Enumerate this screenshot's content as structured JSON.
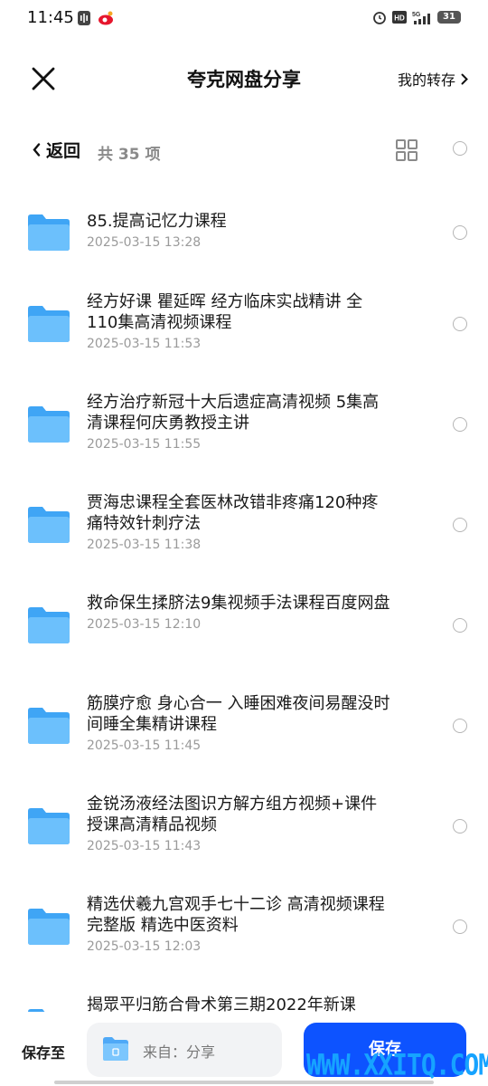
{
  "status_bar": {
    "time": "11:45",
    "network": "5G",
    "battery": "31"
  },
  "header": {
    "title": "夸克网盘分享",
    "my_transfer": "我的转存"
  },
  "subbar": {
    "back_label": "返回",
    "count": "共 35 项"
  },
  "files": [
    {
      "name": "85.提高记忆力课程",
      "date": "2025-03-15 13:28"
    },
    {
      "name": "经方好课 瞿延晖 经方临床实战精讲 全110集高清视频课程",
      "date": "2025-03-15 11:53"
    },
    {
      "name": "经方治疗新冠十大后遗症高清视频 5集高清课程何庆勇教授主讲",
      "date": "2025-03-15 11:55"
    },
    {
      "name": "贾海忠课程全套医林改错非疼痛120种疼痛特效针刺疗法",
      "date": "2025-03-15 11:38"
    },
    {
      "name": "救命保生揉脐法9集视频手法课程百度网盘",
      "date": "2025-03-15 12:10"
    },
    {
      "name": "筋膜疗愈 身心合一  入睡困难夜间易醒没时间睡全集精讲课程",
      "date": "2025-03-15 11:45"
    },
    {
      "name": "金锐汤液经法图识方解方组方视频+课件授课高清精品视频",
      "date": "2025-03-15 11:43"
    },
    {
      "name": "精选伏羲九宫观手七十二诊 高清视频课程完整版 精选中医资料",
      "date": "2025-03-15 12:03"
    },
    {
      "name": "揭眾平归筋合骨术第三期2022年新课",
      "date": ""
    }
  ],
  "bottom": {
    "save_to_label": "保存至",
    "destination": "来自：分享",
    "save_button": "保存",
    "watermark": "WWW.XXITQ.COM"
  },
  "colors": {
    "accent": "#0d53ff",
    "folder": "#4fb0fb",
    "watermark": "#16a3ff"
  }
}
